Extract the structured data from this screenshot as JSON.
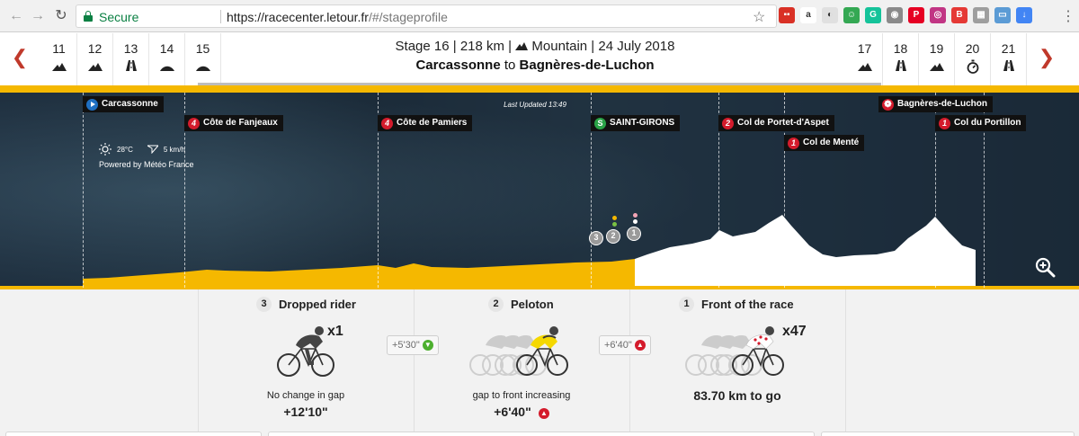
{
  "browser": {
    "secure_label": "Secure",
    "url_host": "https://racecenter.letour.fr",
    "url_path": "/#/stageprofile",
    "extensions": [
      {
        "name": "flag-extension-icon",
        "color": "#d93025",
        "glyph": "▪▪"
      },
      {
        "name": "amazon-extension-icon",
        "color": "#ffffff",
        "glyph": "a"
      },
      {
        "name": "circle-extension-icon",
        "color": "#e0e0e0",
        "glyph": "◐"
      },
      {
        "name": "smile-extension-icon",
        "color": "#34a853",
        "glyph": "☺"
      },
      {
        "name": "grammarly-extension-icon",
        "color": "#15c39a",
        "glyph": "G"
      },
      {
        "name": "shield-extension-icon",
        "color": "#8a8a8a",
        "glyph": "◉"
      },
      {
        "name": "pinterest-extension-icon",
        "color": "#e60023",
        "glyph": "P"
      },
      {
        "name": "instagram-extension-icon",
        "color": "#c13584",
        "glyph": "◎"
      },
      {
        "name": "buffer-extension-icon",
        "color": "#e53935",
        "glyph": "B"
      },
      {
        "name": "table-extension-icon",
        "color": "#9e9e9e",
        "glyph": "▦"
      },
      {
        "name": "window-extension-icon",
        "color": "#5b9bd5",
        "glyph": "▭"
      },
      {
        "name": "download-extension-icon",
        "color": "#4285f4",
        "glyph": "↓"
      }
    ]
  },
  "stages_left": [
    {
      "num": "11",
      "icon": "mountain"
    },
    {
      "num": "12",
      "icon": "mountain"
    },
    {
      "num": "13",
      "icon": "flat"
    },
    {
      "num": "14",
      "icon": "hilly"
    },
    {
      "num": "15",
      "icon": "hilly"
    }
  ],
  "stages_right": [
    {
      "num": "17",
      "icon": "mountain"
    },
    {
      "num": "18",
      "icon": "flat"
    },
    {
      "num": "19",
      "icon": "mountain"
    },
    {
      "num": "20",
      "icon": "time-trial"
    },
    {
      "num": "21",
      "icon": "flat"
    }
  ],
  "stage": {
    "line1_pre": "Stage 16 | 218 km | ",
    "line1_post": " Mountain | 24 July 2018",
    "start": "Carcassonne",
    "to": "to",
    "finish": "Bagnères-de-Luchon"
  },
  "profile": {
    "last_updated": "Last Updated 13:49",
    "weather_temp": "28°C",
    "weather_wind": "5 km/h",
    "weather_powered": "Powered by Météo France",
    "start_flag": "Carcassonne",
    "finish_flag": "Bagnères-de-Luchon",
    "climbs": [
      {
        "cat": "4",
        "name": "Côte de Fanjeaux"
      },
      {
        "cat": "4",
        "name": "Côte de Pamiers"
      },
      {
        "cat": "S",
        "name": "SAINT-GIRONS"
      },
      {
        "cat": "2",
        "name": "Col de Portet-d'Aspet"
      },
      {
        "cat": "1",
        "name": "Col de Menté"
      },
      {
        "cat": "1",
        "name": "Col du Portillon"
      }
    ],
    "group_markers": [
      "3",
      "2",
      "1"
    ],
    "colors": {
      "ridden": "#f5b800",
      "remaining": "#ffffff",
      "sky": "#1c2c3a"
    }
  },
  "groups": [
    {
      "num": "3",
      "title": "Dropped rider",
      "multiplier": "x1",
      "status": "No change in gap",
      "gap": "+12'10\""
    },
    {
      "num": "2",
      "title": "Peloton",
      "status": "gap to front increasing",
      "gap": "+6'40\""
    },
    {
      "num": "1",
      "title": "Front of the race",
      "multiplier": "x47",
      "status": "83.70 km to go"
    }
  ],
  "gaps_between": [
    {
      "value": "+5'30\"",
      "trend": "down"
    },
    {
      "value": "+6'40\"",
      "trend": "up"
    }
  ]
}
